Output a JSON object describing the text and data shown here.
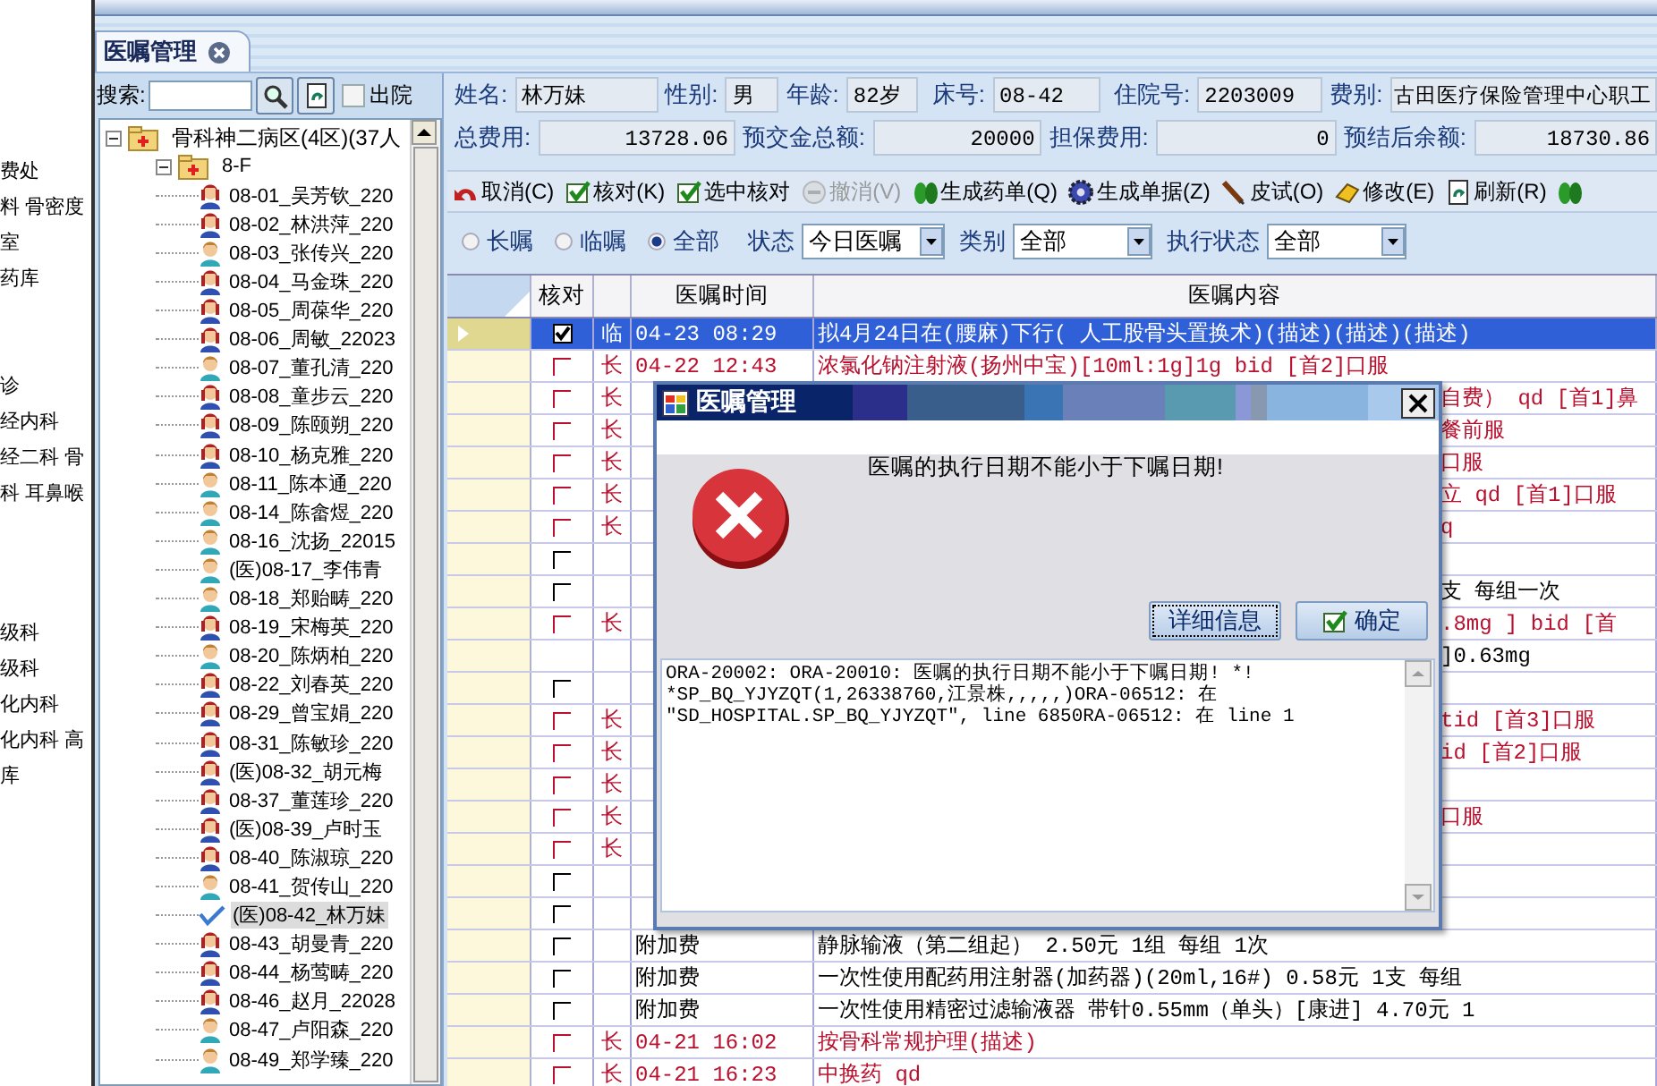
{
  "background_window": {
    "groups": [
      [
        "费处",
        "料 骨密度",
        "室",
        "药库"
      ],
      [
        "诊",
        "经内科",
        "经二科 骨",
        "科 耳鼻喉"
      ],
      [
        "级科",
        "级科",
        "化内科",
        "化内科 高",
        "库"
      ]
    ]
  },
  "tab": {
    "label": "医嘱管理"
  },
  "sidebar": {
    "search_label": "搜索:",
    "discharged_label": "出院",
    "discharged_checked": false,
    "tree": [
      {
        "label": "骨科神二病区(4区)(37人",
        "expanded": true,
        "children": [
          {
            "label": "8-F",
            "expanded": true,
            "children": [
              {
                "label": "08-01_吴芳钦_220",
                "kind": "female",
                "selected": false
              },
              {
                "label": "08-02_林洪萍_220",
                "kind": "female",
                "selected": false
              },
              {
                "label": "08-03_张传兴_220",
                "kind": "male",
                "selected": false
              },
              {
                "label": "08-04_马金珠_220",
                "kind": "female",
                "selected": false
              },
              {
                "label": "08-05_周葆华_220",
                "kind": "female",
                "selected": false
              },
              {
                "label": "08-06_周敏_22023",
                "kind": "female",
                "selected": false
              },
              {
                "label": "08-07_董孔清_220",
                "kind": "male",
                "selected": false
              },
              {
                "label": "08-08_童步云_220",
                "kind": "female",
                "selected": false
              },
              {
                "label": "08-09_陈颐朔_220",
                "kind": "female",
                "selected": false
              },
              {
                "label": "08-10_杨克雅_220",
                "kind": "female",
                "selected": false
              },
              {
                "label": "08-11_陈本通_220",
                "kind": "male",
                "selected": false
              },
              {
                "label": "08-14_陈畲煜_220",
                "kind": "male",
                "selected": false
              },
              {
                "label": "08-16_沈扬_22015",
                "kind": "male",
                "selected": false
              },
              {
                "label": "(医)08-17_李伟青",
                "kind": "male",
                "selected": false
              },
              {
                "label": "08-18_郑贻畴_220",
                "kind": "male",
                "selected": false
              },
              {
                "label": "08-19_宋梅英_220",
                "kind": "female",
                "selected": false
              },
              {
                "label": "08-20_陈炳柏_220",
                "kind": "male",
                "selected": false
              },
              {
                "label": "08-22_刘春英_220",
                "kind": "female",
                "selected": false
              },
              {
                "label": "08-29_曾宝娟_220",
                "kind": "female",
                "selected": false
              },
              {
                "label": "08-31_陈敏珍_220",
                "kind": "female",
                "selected": false
              },
              {
                "label": "(医)08-32_胡元梅",
                "kind": "female",
                "selected": false
              },
              {
                "label": "08-37_董莲珍_220",
                "kind": "female",
                "selected": false
              },
              {
                "label": "(医)08-39_卢时玉",
                "kind": "female",
                "selected": false
              },
              {
                "label": "08-40_陈淑琼_220",
                "kind": "female",
                "selected": false
              },
              {
                "label": "08-41_贺传山_220",
                "kind": "male",
                "selected": false
              },
              {
                "label": "(医)08-42_林万妹",
                "selected": true
              },
              {
                "label": "08-43_胡曼青_220",
                "kind": "female",
                "selected": false
              },
              {
                "label": "08-44_杨莺畴_220",
                "kind": "female",
                "selected": false
              },
              {
                "label": "08-46_赵月_22028",
                "kind": "female",
                "selected": false
              },
              {
                "label": "08-47_卢阳森_220",
                "kind": "male",
                "selected": false
              },
              {
                "label": "08-49_郑学臻_220",
                "kind": "male",
                "selected": false
              }
            ]
          }
        ]
      }
    ]
  },
  "patient": {
    "info": [
      {
        "label": "姓名:",
        "value": "林万妹"
      },
      {
        "label": "性别:",
        "value": "男"
      },
      {
        "label": "年龄:",
        "value": "82岁"
      },
      {
        "label": "床号:",
        "value": "08-42"
      },
      {
        "label": "住院号:",
        "value": "2203009"
      },
      {
        "label": "费别:",
        "value": "古田医疗保险管理中心职工"
      }
    ],
    "totals": [
      {
        "label": "总费用:",
        "value": "13728.06"
      },
      {
        "label": "预交金总额:",
        "value": "20000"
      },
      {
        "label": "担保费用:",
        "value": "0"
      },
      {
        "label": "预结后余额:",
        "value": "18730.86"
      }
    ]
  },
  "toolbar": [
    {
      "label": "取消(C)",
      "kind": "undo",
      "disabled": false
    },
    {
      "label": "核对(K)",
      "kind": "check",
      "disabled": false
    },
    {
      "label": "选中核对",
      "kind": "check",
      "disabled": false
    },
    {
      "label": "撤消(V)",
      "kind": "minus",
      "disabled": true
    },
    {
      "label": "生成药单(Q)",
      "kind": "pills",
      "disabled": false
    },
    {
      "label": "生成单据(Z)",
      "kind": "gear",
      "disabled": false
    },
    {
      "label": "皮试(O)",
      "kind": "syringe",
      "disabled": false
    },
    {
      "label": "修改(E)",
      "kind": "eraser",
      "disabled": false
    },
    {
      "label": "刷新(R)",
      "kind": "refresh",
      "disabled": false
    },
    {
      "kind": "pills",
      "disabled": false
    }
  ],
  "filter": {
    "radios": [
      {
        "label": "长嘱",
        "selected": false
      },
      {
        "label": "临嘱",
        "selected": false
      },
      {
        "label": "全部",
        "selected": true
      }
    ],
    "dropdowns": [
      {
        "label": "状态",
        "value": "今日医嘱"
      },
      {
        "label": "类别",
        "value": "全部"
      },
      {
        "label": "执行状态",
        "value": "全部"
      }
    ]
  },
  "table": {
    "columns": [
      {
        "label": "核对"
      },
      {
        "label": "医嘱时间"
      },
      {
        "label": "医嘱内容"
      }
    ],
    "rows": [
      {
        "kind": "order",
        "selected": true,
        "checked": true,
        "type": "临",
        "time": "04-23 08:29",
        "content": "拟4月24日在(腰麻)下行( 人工股骨头置换术)(描述)(描述)(描述)",
        "partly_hidden": false
      },
      {
        "kind": "order",
        "selected": false,
        "checked": false,
        "type": "长",
        "time": "04-22 12:43",
        "content": "浓氯化钠注射液(扬州中宝)[10ml:1g]1g  bid [首2]口服",
        "partly_hidden": false
      },
      {
        "kind": "order",
        "selected": false,
        "checked": false,
        "type": "长",
        "content": "自费） qd [首1]鼻",
        "partly_hidden": true
      },
      {
        "kind": "order",
        "selected": false,
        "checked": false,
        "type": "长",
        "content": "餐前服",
        "partly_hidden": true
      },
      {
        "kind": "order",
        "selected": false,
        "checked": false,
        "type": "长",
        "content": "口服",
        "partly_hidden": true
      },
      {
        "kind": "order",
        "selected": false,
        "checked": false,
        "type": "长",
        "content": "立 qd [首1]口服",
        "partly_hidden": true
      },
      {
        "kind": "order",
        "selected": false,
        "checked": false,
        "type": "长",
        "content": "q",
        "partly_hidden": true
      },
      {
        "kind": "fee",
        "selected": false,
        "checked": false
      },
      {
        "kind": "fee",
        "selected": false,
        "checked": false,
        "content": "支  每组一次",
        "partly_hidden": true
      },
      {
        "kind": "order",
        "selected": false,
        "checked": false,
        "type": "长",
        "content": ".8mg  ]  bid [首",
        "partly_hidden": true
      },
      {
        "kind": "continuation",
        "selected": false,
        "content": "]0.63mg",
        "partly_hidden": true
      },
      {
        "kind": "fee",
        "selected": false,
        "checked": false
      },
      {
        "kind": "order",
        "selected": false,
        "checked": false,
        "type": "长",
        "content": "tid [首3]口服",
        "partly_hidden": true
      },
      {
        "kind": "order",
        "selected": false,
        "checked": false,
        "type": "长",
        "content": "id [首2]口服",
        "partly_hidden": true
      },
      {
        "kind": "order",
        "selected": false,
        "checked": false,
        "type": "长"
      },
      {
        "kind": "order",
        "selected": false,
        "checked": false,
        "type": "长",
        "content": "口服",
        "partly_hidden": true
      },
      {
        "kind": "order",
        "selected": false,
        "checked": false,
        "type": "长"
      },
      {
        "kind": "fee",
        "selected": false,
        "checked": false
      },
      {
        "kind": "fee",
        "selected": false,
        "checked": false
      },
      {
        "kind": "fee",
        "selected": false,
        "checked": false,
        "time": "附加费",
        "content": "静脉输液（第二组起）  2.50元 1组  每组 1次",
        "partly_hidden": false
      },
      {
        "kind": "fee",
        "selected": false,
        "checked": false,
        "time": "附加费",
        "content": "一次性使用配药用注射器(加药器)(20ml,16#)   0.58元 1支  每组",
        "partly_hidden": false
      },
      {
        "kind": "fee",
        "selected": false,
        "checked": false,
        "time": "附加费",
        "content": "一次性使用精密过滤输液器 带针0.55mm（单头）[康进]  4.70元 1",
        "partly_hidden": false
      },
      {
        "kind": "order",
        "selected": false,
        "checked": false,
        "type": "长",
        "time": "04-21 16:02",
        "content": "按骨科常规护理(描述)",
        "partly_hidden": false
      },
      {
        "kind": "order",
        "selected": false,
        "checked": false,
        "type": "长",
        "time": "04-21 16:23",
        "content": "中换药 qd",
        "partly_hidden": false
      }
    ]
  },
  "dialog": {
    "title": "医嘱管理",
    "message": "医嘱的执行日期不能小于下嘱日期!",
    "buttons": [
      {
        "label": "详细信息",
        "focused": true,
        "kind": "plain"
      },
      {
        "label": "确定",
        "focused": false,
        "kind": "confirm"
      }
    ],
    "details": [
      "ORA-20002: ORA-20010: 医嘱的执行日期不能小于下嘱日期! *!",
      "*SP_BQ_YJYZQT(1,26338760,江景株,,,,,)ORA-06512: 在",
      "\"SD_HOSPITAL.SP_BQ_YJYZQT\", line 6850RA-06512: 在 line 1"
    ]
  }
}
